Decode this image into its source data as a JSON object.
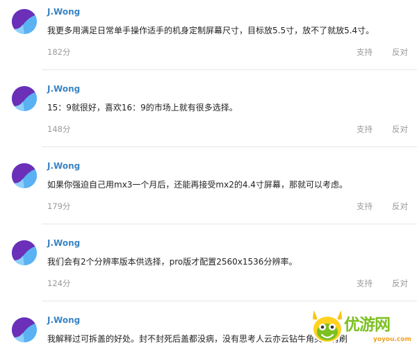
{
  "comments": [
    {
      "author": "J.Wong",
      "text": "我更多用满足日常单手操作适手的机身定制屏幕尺寸，目标放5.5寸，放不了就放5.4寸。",
      "score": "182分",
      "support": "支持",
      "oppose": "反对"
    },
    {
      "author": "J.Wong",
      "text": "15：9就很好，喜欢16：9的市场上就有很多选择。",
      "score": "148分",
      "support": "支持",
      "oppose": "反对"
    },
    {
      "author": "J.Wong",
      "text": "如果你强迫自己用mx3一个月后，还能再接受mx2的4.4寸屏幕，那就可以考虑。",
      "score": "179分",
      "support": "支持",
      "oppose": "反对"
    },
    {
      "author": "J.Wong",
      "text": "我们会有2个分辨率版本供选择，pro版才配置2560x1536分辨率。",
      "score": "124分",
      "support": "支持",
      "oppose": "反对"
    },
    {
      "author": "J.Wong",
      "text": "我解释过可拆盖的好处。封不封死后盖都没病，没有思考人云亦云钻牛角尖只有刷",
      "score": "",
      "support": "",
      "oppose": ""
    }
  ],
  "watermark": {
    "text": "优游网",
    "domain": "yoyou.com",
    "icon": "mascot-logo"
  },
  "colors": {
    "author": "#3a84c4",
    "text": "#222222",
    "meta": "#999999",
    "divider": "#e6e6e6",
    "avatar_bg": "#5ab2f2",
    "avatar_accent": "#6b2fb8",
    "watermark_green": "#7cc021"
  }
}
